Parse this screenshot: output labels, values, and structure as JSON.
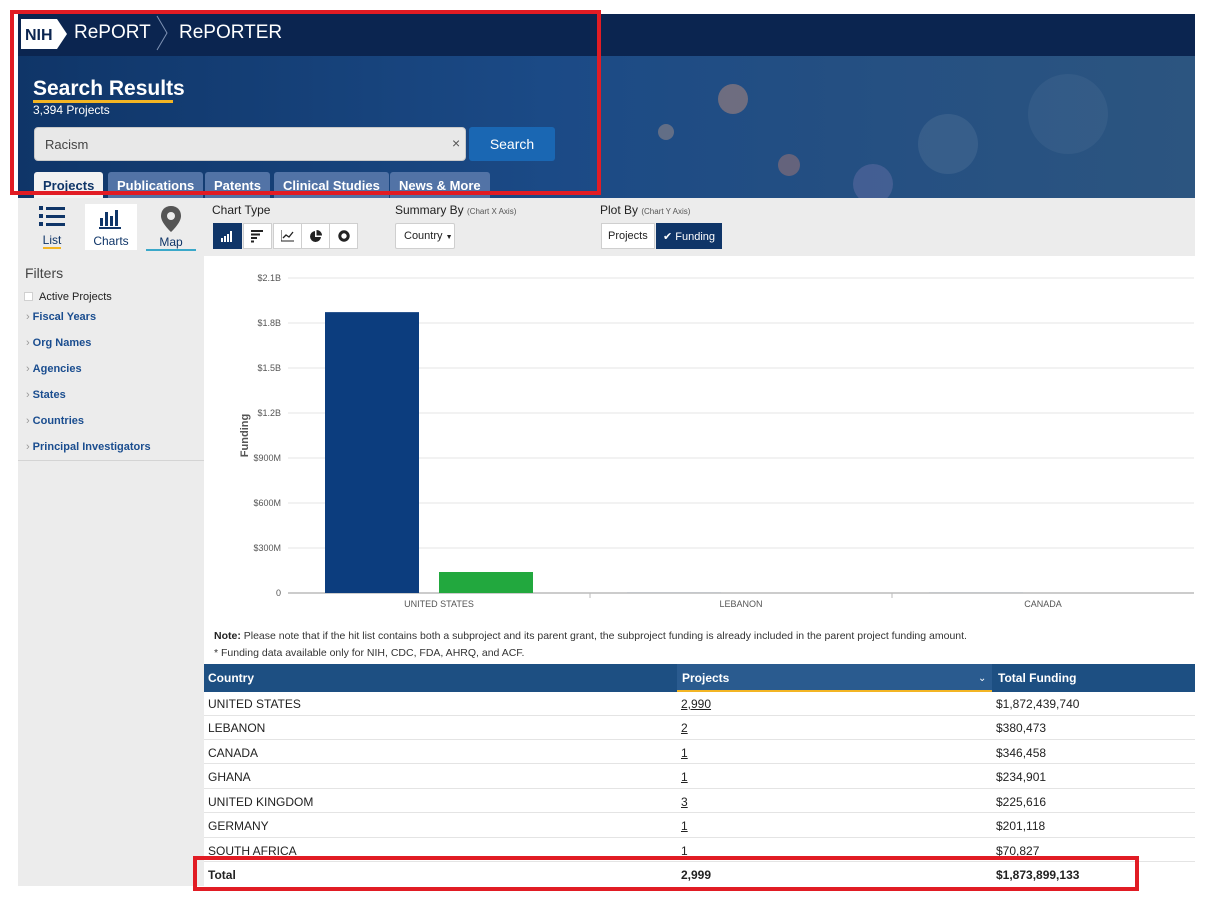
{
  "header": {
    "logo_text": "NIH",
    "crumb_report": "RePORT",
    "crumb_reporter": "RePORTER",
    "page_title": "Search Results",
    "project_count": "3,394 Projects",
    "search_value": "Racism",
    "search_button": "Search",
    "tabs": [
      "Projects",
      "Publications",
      "Patents",
      "Clinical Studies",
      "News & More"
    ]
  },
  "views": [
    {
      "label": "List",
      "icon": "list-icon"
    },
    {
      "label": "Charts",
      "icon": "bar-chart-icon"
    },
    {
      "label": "Map",
      "icon": "map-pin-icon"
    }
  ],
  "filters": {
    "title": "Filters",
    "active_projects": "Active Projects",
    "items": [
      "Fiscal Years",
      "Org Names",
      "Agencies",
      "States",
      "Countries",
      "Principal Investigators"
    ]
  },
  "controls": {
    "chart_type_label": "Chart Type",
    "chart_types": [
      "vertical-bar-icon",
      "horizontal-bar-icon",
      "line-chart-icon",
      "pie-chart-icon",
      "donut-chart-icon"
    ],
    "summary_by_label": "Summary By",
    "summary_by_hint": "(Chart X Axis)",
    "summary_by_value": "Country",
    "plot_by_label": "Plot By",
    "plot_by_hint": "(Chart Y Axis)",
    "plot_by_options": [
      "Projects",
      "Funding"
    ],
    "plot_by_selected": "Funding"
  },
  "chart_data": {
    "type": "bar",
    "ylabel": "Funding",
    "xlabel": "",
    "ylim": [
      0,
      2100000000
    ],
    "y_ticks": [
      "0",
      "$300M",
      "$600M",
      "$900M",
      "$1.2B",
      "$1.5B",
      "$1.8B",
      "$2.1B"
    ],
    "y_tick_values": [
      0,
      300000000,
      600000000,
      900000000,
      1200000000,
      1500000000,
      1800000000,
      2100000000
    ],
    "categories": [
      "UNITED STATES",
      "LEBANON",
      "CANADA"
    ],
    "series": [
      {
        "color": "#0c3d7e",
        "values": [
          1872439740,
          380473,
          346458
        ]
      },
      {
        "color": "#22a83e",
        "values": [
          140000000,
          0,
          0
        ]
      }
    ],
    "grid": true
  },
  "notes": {
    "note_label": "Note:",
    "note_text": " Please note that if the hit list contains both a subproject and its parent grant, the subproject funding is already included in the parent project funding amount.",
    "funding_note": "* Funding data available only for NIH, CDC, FDA, AHRQ, and ACF."
  },
  "table": {
    "columns": [
      "Country",
      "Projects",
      "Total Funding"
    ],
    "rows": [
      {
        "country": "UNITED STATES",
        "projects": "2,990",
        "funding": "$1,872,439,740"
      },
      {
        "country": "LEBANON",
        "projects": "2",
        "funding": "$380,473"
      },
      {
        "country": "CANADA",
        "projects": "1",
        "funding": "$346,458"
      },
      {
        "country": "GHANA",
        "projects": "1",
        "funding": "$234,901"
      },
      {
        "country": "UNITED KINGDOM",
        "projects": "3",
        "funding": "$225,616"
      },
      {
        "country": "GERMANY",
        "projects": "1",
        "funding": "$201,118"
      },
      {
        "country": "SOUTH AFRICA",
        "projects": "1",
        "funding": "$70,827"
      }
    ],
    "total": {
      "label": "Total",
      "projects": "2,999",
      "funding": "$1,873,899,133"
    }
  },
  "colors": {
    "header_dark": "#0b2550",
    "accent_yellow": "#f3b524",
    "highlight_red": "#e11c24",
    "table_head": "#1d4f82"
  }
}
